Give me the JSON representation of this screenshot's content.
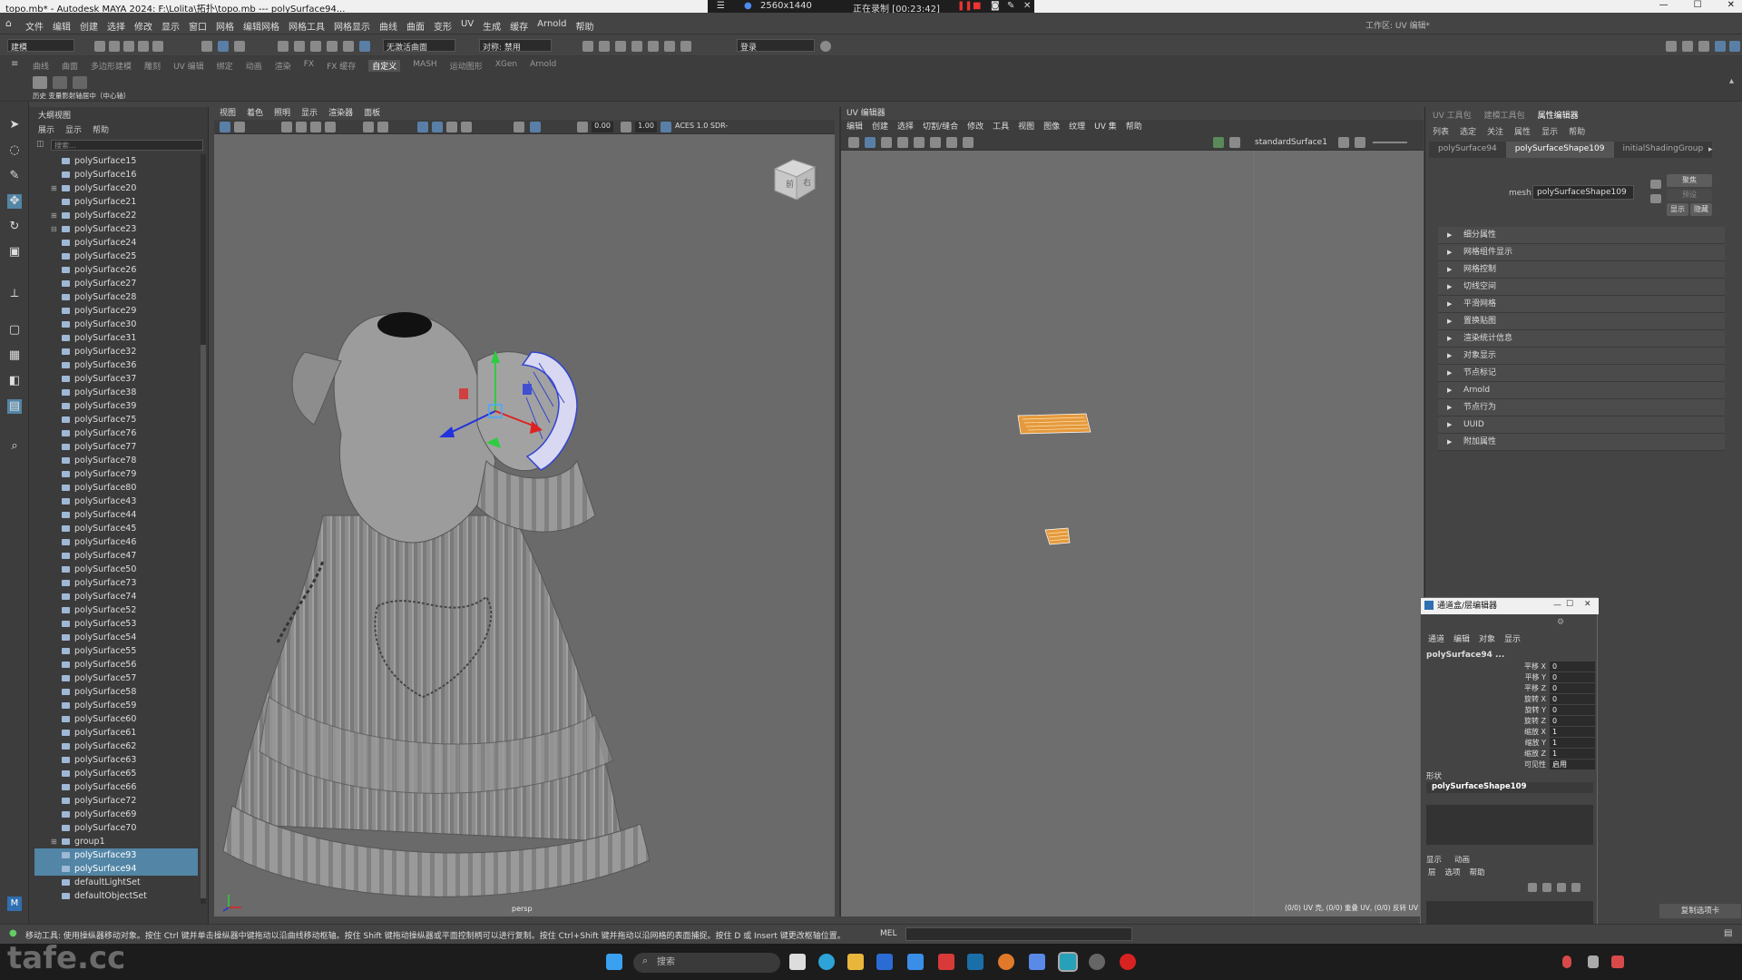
{
  "window": {
    "title": "topo.mb* - Autodesk MAYA 2024: F:\\Lolita\\拓扑\\topo.mb   ---   polySurface94...",
    "recorder_resolution": "2560x1440",
    "recorder_status": "正在录制 [00:23:42]"
  },
  "menubar": [
    "文件",
    "编辑",
    "创建",
    "选择",
    "修改",
    "显示",
    "窗口",
    "网格",
    "编辑网格",
    "网格工具",
    "网格显示",
    "曲线",
    "曲面",
    "变形",
    "UV",
    "生成",
    "缓存",
    "Arnold",
    "帮助"
  ],
  "workspace_label": "工作区: UV 编辑*",
  "statusline": {
    "mode": "建模",
    "object_name_placeholder": "无激活曲面",
    "symmetry": "对称: 禁用",
    "login": "登录"
  },
  "shelf_tabs": [
    "曲线",
    "曲面",
    "多边形建模",
    "雕刻",
    "UV 编辑",
    "绑定",
    "动画",
    "渲染",
    "FX",
    "FX 缓存",
    "自定义",
    "MASH",
    "运动图形",
    "XGen",
    "Arnold"
  ],
  "shelf_active": "自定义",
  "shelf_label": "历史   变量影射轴居中（中心轴）",
  "outliner": {
    "title": "大纲视图",
    "menu": [
      "展示",
      "显示",
      "帮助"
    ],
    "search_placeholder": "搜索...",
    "items": [
      {
        "name": "polySurface15"
      },
      {
        "name": "polySurface16"
      },
      {
        "name": "polySurface20",
        "expand": "+"
      },
      {
        "name": "polySurface21"
      },
      {
        "name": "polySurface22",
        "expand": "+"
      },
      {
        "name": "polySurface23",
        "expand": "-"
      },
      {
        "name": "polySurface24"
      },
      {
        "name": "polySurface25"
      },
      {
        "name": "polySurface26"
      },
      {
        "name": "polySurface27"
      },
      {
        "name": "polySurface28"
      },
      {
        "name": "polySurface29"
      },
      {
        "name": "polySurface30"
      },
      {
        "name": "polySurface31"
      },
      {
        "name": "polySurface32"
      },
      {
        "name": "polySurface36"
      },
      {
        "name": "polySurface37"
      },
      {
        "name": "polySurface38"
      },
      {
        "name": "polySurface39"
      },
      {
        "name": "polySurface75"
      },
      {
        "name": "polySurface76"
      },
      {
        "name": "polySurface77"
      },
      {
        "name": "polySurface78"
      },
      {
        "name": "polySurface79"
      },
      {
        "name": "polySurface80"
      },
      {
        "name": "polySurface43"
      },
      {
        "name": "polySurface44"
      },
      {
        "name": "polySurface45"
      },
      {
        "name": "polySurface46"
      },
      {
        "name": "polySurface47"
      },
      {
        "name": "polySurface50"
      },
      {
        "name": "polySurface73"
      },
      {
        "name": "polySurface74"
      },
      {
        "name": "polySurface52"
      },
      {
        "name": "polySurface53"
      },
      {
        "name": "polySurface54"
      },
      {
        "name": "polySurface55"
      },
      {
        "name": "polySurface56"
      },
      {
        "name": "polySurface57"
      },
      {
        "name": "polySurface58"
      },
      {
        "name": "polySurface59"
      },
      {
        "name": "polySurface60"
      },
      {
        "name": "polySurface61"
      },
      {
        "name": "polySurface62"
      },
      {
        "name": "polySurface63"
      },
      {
        "name": "polySurface65"
      },
      {
        "name": "polySurface66"
      },
      {
        "name": "polySurface72"
      },
      {
        "name": "polySurface69"
      },
      {
        "name": "polySurface70"
      },
      {
        "name": "group1",
        "expand": "+"
      },
      {
        "name": "polySurface93",
        "selected": true
      },
      {
        "name": "polySurface94",
        "selected": true
      },
      {
        "name": "defaultLightSet"
      },
      {
        "name": "defaultObjectSet"
      }
    ]
  },
  "viewport": {
    "menu": [
      "视图",
      "着色",
      "照明",
      "显示",
      "渲染器",
      "面板"
    ],
    "near_value": "0.00",
    "far_value": "1.00",
    "colorspace": "ACES 1.0 SDR-",
    "camera": "persp",
    "viewcube_labels": [
      "前",
      "右"
    ]
  },
  "uv_editor": {
    "title": "UV 编辑器",
    "menu": [
      "编辑",
      "创建",
      "选择",
      "切割/缝合",
      "修改",
      "工具",
      "视图",
      "图像",
      "纹理",
      "UV 集",
      "帮助"
    ],
    "texture": "standardSurface1",
    "status": "(0/0) UV 壳, (0/0) 重叠 UV, (0/0) 反转 UV"
  },
  "attribute_editor": {
    "tabs": [
      "UV 工具包",
      "建模工具包",
      "属性编辑器"
    ],
    "active_tab": "属性编辑器",
    "menu": [
      "列表",
      "选定",
      "关注",
      "属性",
      "显示",
      "帮助"
    ],
    "nodes": [
      "polySurface94",
      "polySurfaceShape109",
      "initialShadingGroup"
    ],
    "active_node": "polySurfaceShape109",
    "mesh_label": "mesh:",
    "mesh_value": "polySurfaceShape109",
    "focus_btn": "聚焦",
    "preset_btn": "预设",
    "show_btn": "显示",
    "hide_btn": "隐藏",
    "sections": [
      "细分属性",
      "网格组件显示",
      "网格控制",
      "切线空间",
      "平滑网格",
      "置换贴图",
      "渲染统计信息",
      "对象显示",
      "节点标记",
      "Arnold",
      "节点行为",
      "UUID",
      "附加属性"
    ],
    "copy_tab": "复制选项卡"
  },
  "channel_box": {
    "title": "通道盒/层编辑器",
    "menu": [
      "通道",
      "编辑",
      "对象",
      "显示"
    ],
    "object": "polySurface94 ...",
    "channels": [
      {
        "label": "平移 X",
        "value": "0"
      },
      {
        "label": "平移 Y",
        "value": "0"
      },
      {
        "label": "平移 Z",
        "value": "0"
      },
      {
        "label": "旋转 X",
        "value": "0"
      },
      {
        "label": "旋转 Y",
        "value": "0"
      },
      {
        "label": "旋转 Z",
        "value": "0"
      },
      {
        "label": "缩放 X",
        "value": "1"
      },
      {
        "label": "缩放 Y",
        "value": "1"
      },
      {
        "label": "缩放 Z",
        "value": "1"
      },
      {
        "label": "可见性",
        "value": "启用"
      }
    ],
    "shapes_label": "形状",
    "shape_name": "polySurfaceShape109",
    "layer_tabs": [
      "显示",
      "动画"
    ],
    "layer_menu": [
      "层",
      "选项",
      "帮助"
    ]
  },
  "helpline": {
    "text": "移动工具: 使用操纵器移动对象。按住 Ctrl 键并单击操纵器中键拖动以沿曲线移动枢轴。按住 Shift 键拖动操纵器或平面控制柄可以进行复制。按住 Ctrl+Shift 键并拖动以沿网格的表面捕捉。按住 D 或 Insert 键更改枢轴位置。",
    "mel_label": "MEL"
  },
  "taskbar": {
    "search_placeholder": "搜索"
  },
  "watermark": "tafe.cc",
  "colors": {
    "selection": "#5285a6",
    "uv_shell": "#e59a3d"
  }
}
